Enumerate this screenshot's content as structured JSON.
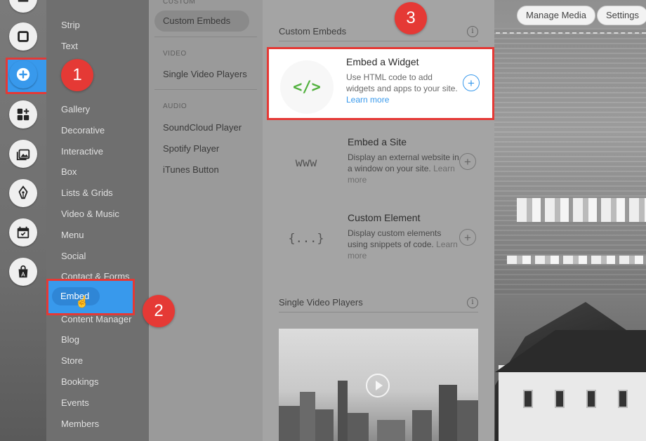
{
  "top_bar": {
    "manage_media": "Manage Media",
    "settings": "Settings"
  },
  "rail": {
    "icons": [
      "square-icon",
      "add-icon",
      "apps-icon",
      "media-icon",
      "pen-icon",
      "calendar-icon",
      "store-icon"
    ],
    "accent": "#3899ec"
  },
  "categories": {
    "items": [
      "Strip",
      "Text",
      "Gallery",
      "Decorative",
      "Interactive",
      "Box",
      "Lists & Grids",
      "Video & Music",
      "Menu",
      "Social",
      "Contact & Forms",
      "Embed",
      "Content Manager",
      "Blog",
      "Store",
      "Bookings",
      "Events",
      "Members"
    ],
    "selected": "Embed"
  },
  "subcategories": {
    "custom_heading": "CUSTOM",
    "custom_embeds": "Custom Embeds",
    "video_heading": "VIDEO",
    "single_video_players": "Single Video Players",
    "audio_heading": "AUDIO",
    "soundcloud": "SoundCloud Player",
    "spotify": "Spotify Player",
    "itunes": "iTunes Button"
  },
  "panel": {
    "custom_embeds_title": "Custom Embeds",
    "cards": [
      {
        "title": "Embed a Widget",
        "glyph": "</>",
        "desc": "Use HTML code to add widgets and apps to your site.",
        "link": "Learn more"
      },
      {
        "title": "Embed a Site",
        "glyph": "www",
        "desc": "Display an external website in a window on your site.",
        "link": "Learn more"
      },
      {
        "title": "Custom Element",
        "glyph": "{...}",
        "desc": "Display custom elements using snippets of code.",
        "link": "Learn more"
      }
    ],
    "single_video_title": "Single Video Players",
    "info": "i"
  },
  "badges": {
    "one": "1",
    "two": "2",
    "three": "3"
  },
  "colors": {
    "highlight": "#e53935",
    "accent": "#3899ec",
    "code_green": "#52b13e"
  }
}
